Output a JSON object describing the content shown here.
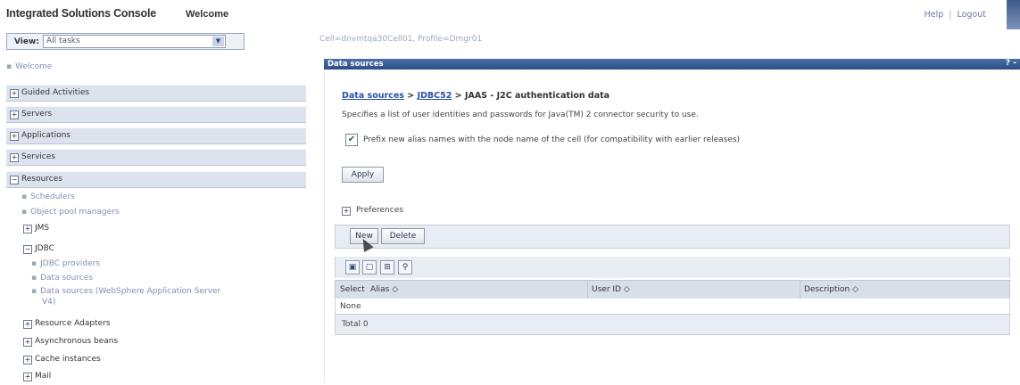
{
  "header": {
    "app_title": "Integrated Solutions Console",
    "welcome": "Welcome",
    "help": "Help",
    "separator": "|",
    "logout": "Logout"
  },
  "nav": {
    "view_label": "View:",
    "view_value": "All tasks",
    "welcome_link": "Welcome",
    "categories": {
      "guided": "Guided Activities",
      "servers": "Servers",
      "applications": "Applications",
      "services": "Services",
      "resources": "Resources"
    },
    "resources_items": {
      "schedulers": "Schedulers",
      "object_pool": "Object pool managers",
      "jms": "JMS",
      "jdbc": "JDBC",
      "jdbc_providers": "JDBC providers",
      "data_sources": "Data sources",
      "data_sources_v4_line1": "Data sources (WebSphere Application Server",
      "data_sources_v4_line2": "V4)",
      "resource_adapters": "Resource Adapters",
      "async_beans": "Asynchronous beans",
      "cache_instances": "Cache instances",
      "mail": "Mail"
    },
    "expand_symbol": "⊞",
    "collapse_symbol": "⊟"
  },
  "content": {
    "scope": "Cell=dnvmtqa30Cell01, Profile=Dmgr01",
    "panel_title": "Data sources",
    "panel_help": "? -",
    "breadcrumb": {
      "root": "Data sources",
      "sep1": " > ",
      "mid": "JDBC52",
      "sep2": " > ",
      "current": "JAAS - J2C authentication data"
    },
    "description": "Specifies a list of user identities and passwords for Java(TM) 2 connector security to use.",
    "prefix_checkbox_label": "Prefix new alias names with the node name of the cell (for compatibility with earlier releases)",
    "prefix_checked": true,
    "apply_button": "Apply",
    "preferences": "Preferences",
    "new_button": "New",
    "delete_button": "Delete",
    "table_icons": [
      "select-all-icon",
      "deselect-all-icon",
      "show-filter-icon",
      "clear-filter-icon"
    ],
    "columns": {
      "select": "Select",
      "alias": "Alias ◇",
      "user_id": "User ID ◇",
      "description": "Description ◇"
    },
    "empty_row": "None",
    "total": "Total 0"
  },
  "colors": {
    "panel_header": "#2d4d86",
    "nav_category_bg": "#dde3ee",
    "link": "#2a52a6"
  }
}
